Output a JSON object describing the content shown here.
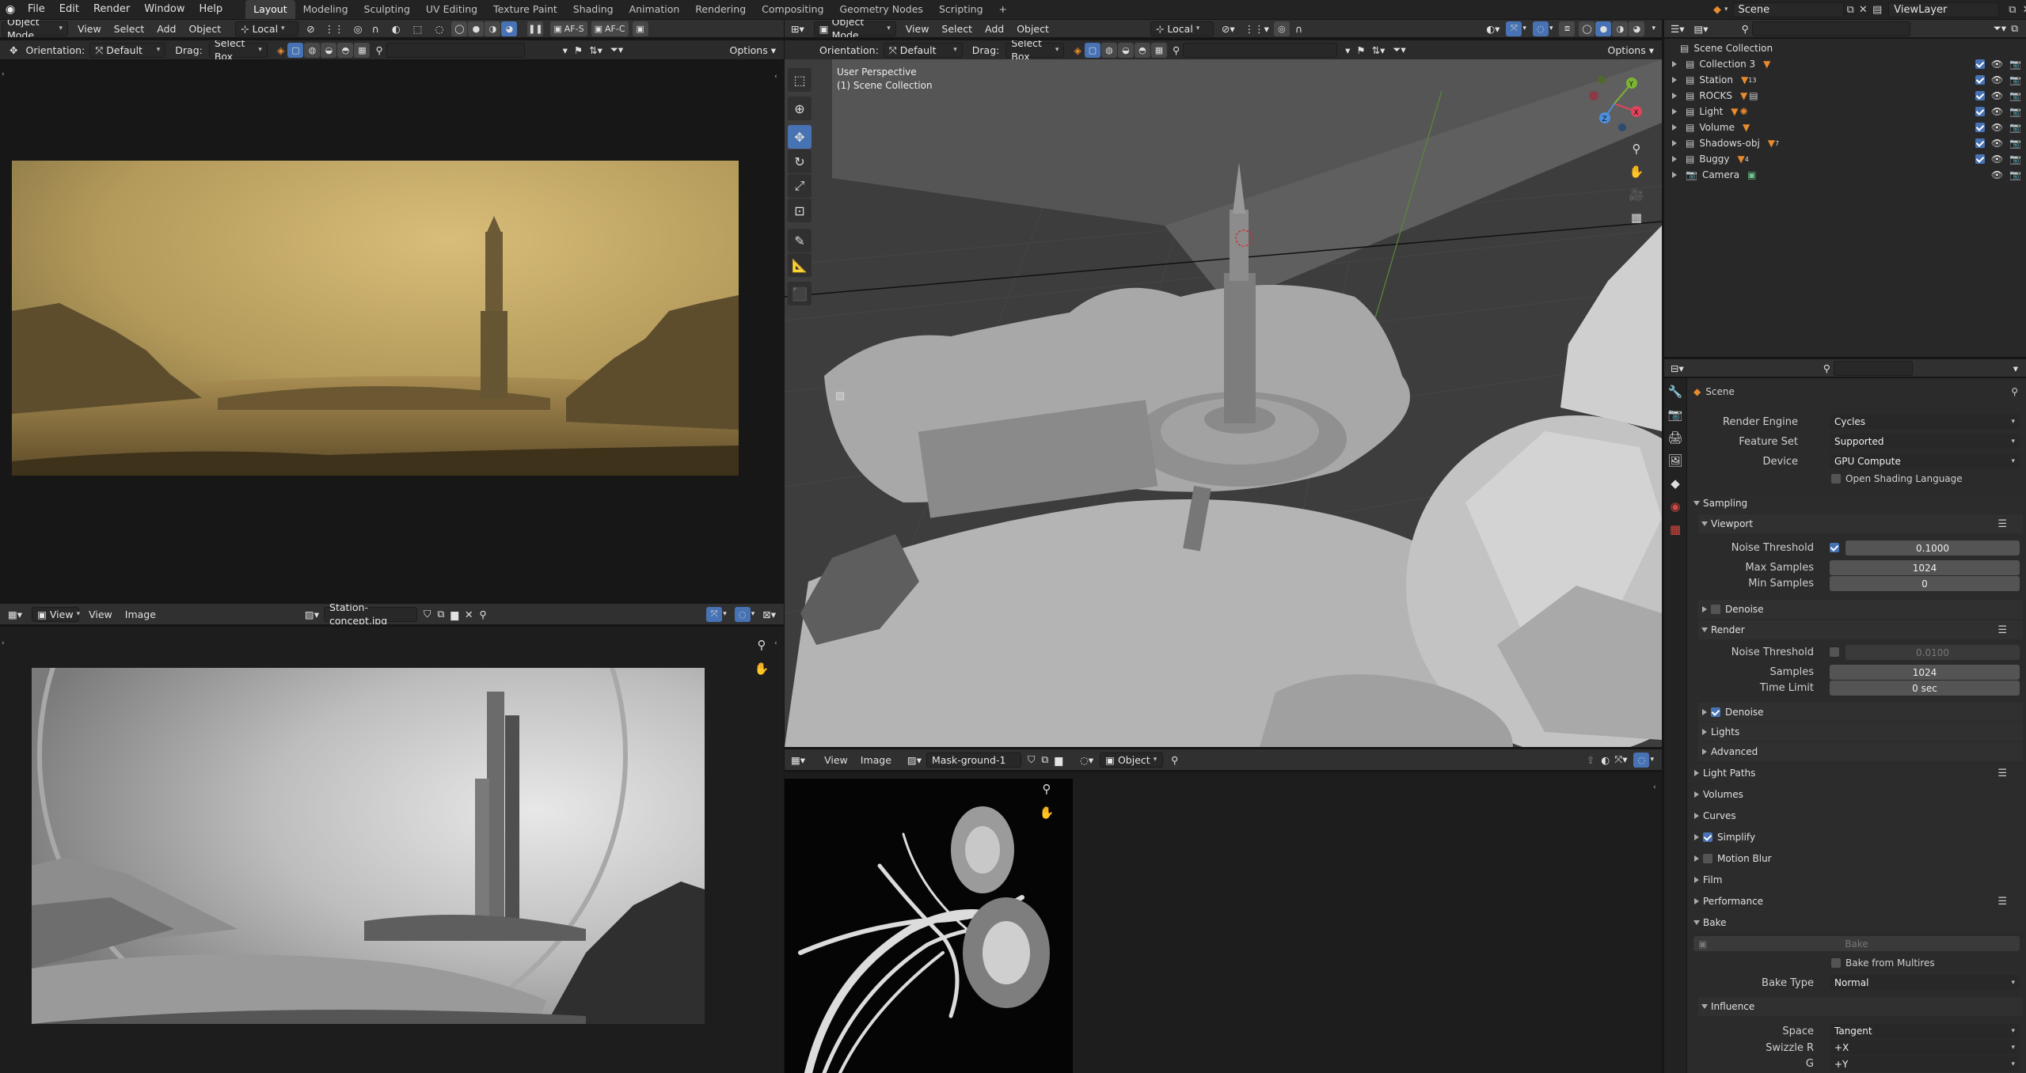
{
  "topbar": {
    "menus": [
      "File",
      "Edit",
      "Render",
      "Window",
      "Help"
    ],
    "workspaces": [
      "Layout",
      "Modeling",
      "Sculpting",
      "UV Editing",
      "Texture Paint",
      "Shading",
      "Animation",
      "Rendering",
      "Compositing",
      "Geometry Nodes",
      "Scripting"
    ],
    "active_workspace": "Layout",
    "scene_label": "Scene",
    "viewlayer_label": "ViewLayer"
  },
  "left_top": {
    "mode": "Object Mode",
    "menus": [
      "View",
      "Select",
      "Add",
      "Object"
    ],
    "transform": "Local",
    "af_s": "AF-S",
    "af_c": "AF-C",
    "orientation_label": "Orientation:",
    "orientation_value": "Default",
    "drag_label": "Drag:",
    "drag_value": "Select Box",
    "options": "Options"
  },
  "image_editor_bottom": {
    "view_btn": "View",
    "menus": [
      "View",
      "Image"
    ],
    "image_name": "Station-concept.jpg"
  },
  "viewport": {
    "mode": "Object Mode",
    "menus": [
      "View",
      "Select",
      "Add",
      "Object"
    ],
    "transform": "Local",
    "orientation_label": "Orientation:",
    "orientation_value": "Default",
    "drag_label": "Drag:",
    "drag_value": "Select Box",
    "options": "Options",
    "overlay_title": "User Perspective",
    "overlay_subtitle": "(1) Scene Collection",
    "gizmo": {
      "x": "X",
      "y": "Y",
      "z": "Z"
    }
  },
  "mask_editor": {
    "menus": [
      "View",
      "Image"
    ],
    "image_name": "Mask-ground-1",
    "object_mode": "Object"
  },
  "outliner": {
    "root": "Scene Collection",
    "items": [
      {
        "name": "Collection 3",
        "badge": ""
      },
      {
        "name": "Station",
        "badge": "13"
      },
      {
        "name": "ROCKS",
        "badge": ""
      },
      {
        "name": "Light",
        "badge": ""
      },
      {
        "name": "Volume",
        "badge": ""
      },
      {
        "name": "Shadows-obj",
        "badge": "7"
      },
      {
        "name": "Buggy",
        "badge": "4"
      },
      {
        "name": "Camera",
        "badge": ""
      }
    ]
  },
  "properties": {
    "scene_label": "Scene",
    "render_engine_label": "Render Engine",
    "render_engine": "Cycles",
    "feature_set_label": "Feature Set",
    "feature_set": "Supported",
    "device_label": "Device",
    "device": "GPU Compute",
    "osl_label": "Open Shading Language",
    "sampling": "Sampling",
    "viewport_sub": "Viewport",
    "noise_threshold_label": "Noise Threshold",
    "viewport_noise": "0.1000",
    "max_samples_label": "Max Samples",
    "max_samples": "1024",
    "min_samples_label": "Min Samples",
    "min_samples": "0",
    "denoise": "Denoise",
    "render_sub": "Render",
    "render_noise": "0.0100",
    "samples_label": "Samples",
    "samples": "1024",
    "time_limit_label": "Time Limit",
    "time_limit": "0 sec",
    "denoise2": "Denoise",
    "lights": "Lights",
    "advanced": "Advanced",
    "light_paths": "Light Paths",
    "volumes": "Volumes",
    "curves": "Curves",
    "simplify": "Simplify",
    "motion_blur": "Motion Blur",
    "film": "Film",
    "performance": "Performance",
    "bake_section": "Bake",
    "bake_button": "Bake",
    "bake_multires": "Bake from Multires",
    "bake_type_label": "Bake Type",
    "bake_type": "Normal",
    "influence": "Influence",
    "space_label": "Space",
    "space": "Tangent",
    "swizzle_r_label": "Swizzle R",
    "swizzle_r": "+X",
    "g_label": "G",
    "g": "+Y"
  },
  "colors": {
    "accent_blue": "#4772b3",
    "panel_bg": "#303030",
    "dark_bg": "#1a1a1a",
    "orange_icon": "#e88a2e"
  }
}
